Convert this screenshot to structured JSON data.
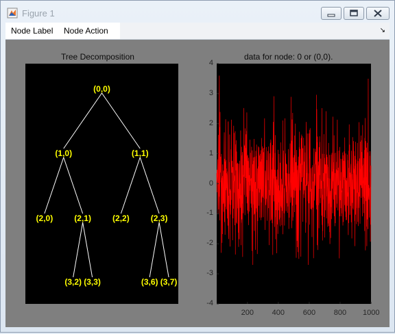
{
  "window": {
    "title": "Figure 1",
    "app_icon": "matlab-figure-icon",
    "controls": [
      "minimize-icon",
      "maximize-icon",
      "close-icon"
    ]
  },
  "menu": {
    "items": [
      "Node Label",
      "Node Action"
    ],
    "dock_icon": "dock-arrow-icon",
    "dock_glyph": "↘"
  },
  "colors": {
    "figure_bg": "#7f7f7f",
    "axes_bg": "#000000",
    "node_label": "#ffff00",
    "tree_edge": "#ffffff",
    "signal": "#ff0000"
  },
  "tree": {
    "title": "Tree Decomposition",
    "nodes": [
      {
        "id": "(0,0)",
        "parent": null
      },
      {
        "id": "(1,0)",
        "parent": "(0,0)"
      },
      {
        "id": "(1,1)",
        "parent": "(0,0)"
      },
      {
        "id": "(2,0)",
        "parent": "(1,0)"
      },
      {
        "id": "(2,1)",
        "parent": "(1,0)"
      },
      {
        "id": "(2,2)",
        "parent": "(1,1)"
      },
      {
        "id": "(2,3)",
        "parent": "(1,1)"
      },
      {
        "id": "(3,2)",
        "parent": "(2,1)"
      },
      {
        "id": "(3,3)",
        "parent": "(2,1)"
      },
      {
        "id": "(3,6)",
        "parent": "(2,3)"
      },
      {
        "id": "(3,7)",
        "parent": "(2,3)"
      }
    ]
  },
  "chart_data": {
    "type": "line",
    "title": "data for node: 0 or (0,0).",
    "xlabel": "",
    "ylabel": "",
    "xlim": [
      1,
      1000
    ],
    "ylim": [
      -4,
      4
    ],
    "xticks": [
      200,
      400,
      600,
      800,
      1000
    ],
    "yticks": [
      -4,
      -3,
      -2,
      -1,
      0,
      1,
      2,
      3,
      4
    ],
    "grid": false,
    "series": [
      {
        "color": "#ff0000",
        "n_points": 1000,
        "mean": 0,
        "std": 1,
        "min": -2.7,
        "max": 3.6
      }
    ]
  }
}
